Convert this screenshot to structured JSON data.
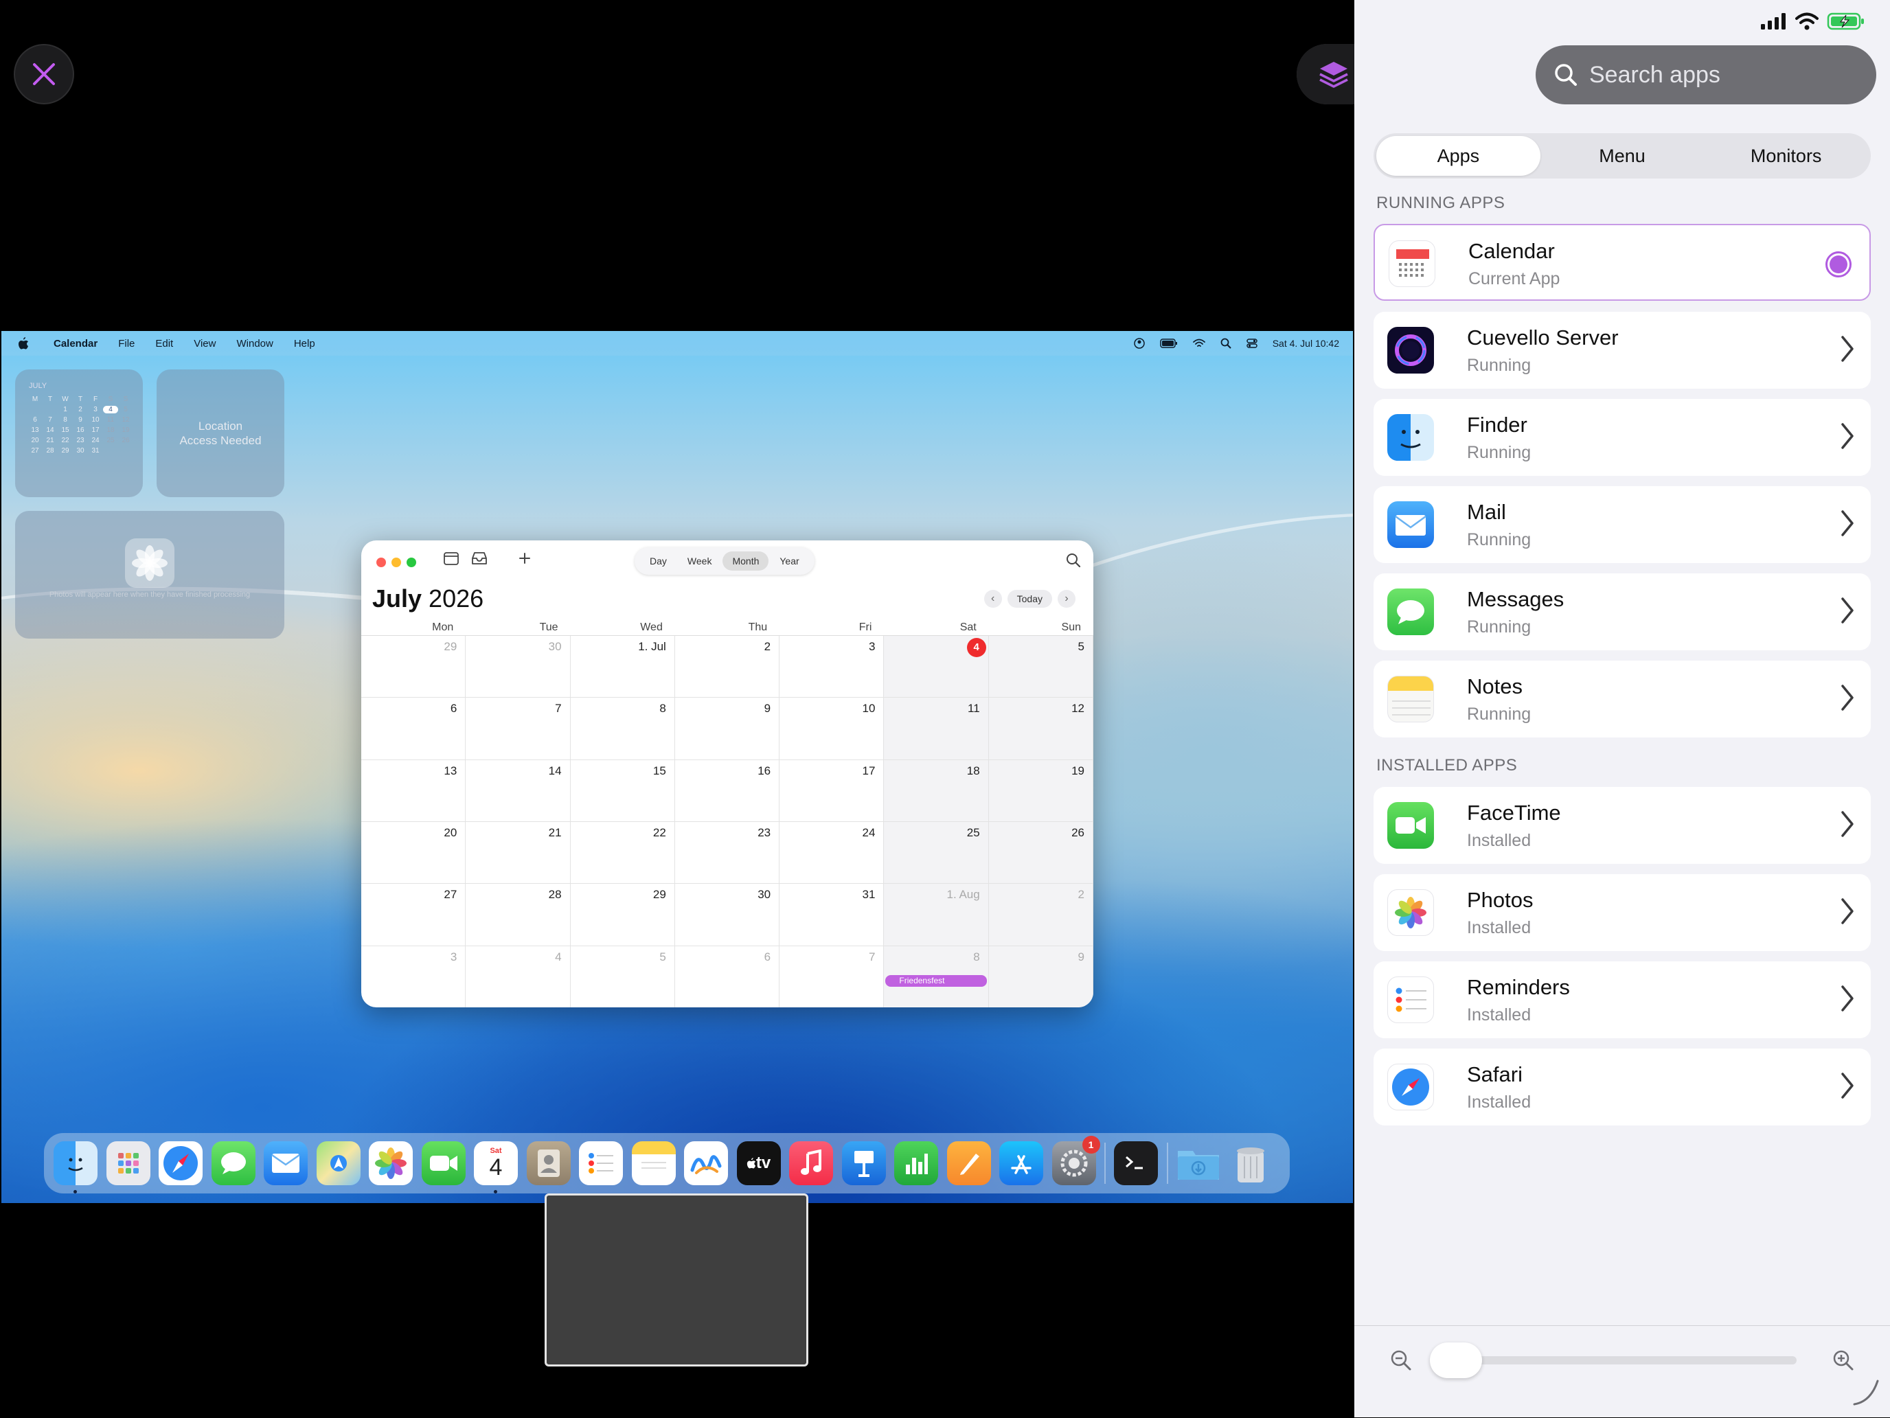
{
  "mac": {
    "menubar": {
      "app_name": "Calendar",
      "menus": [
        "File",
        "Edit",
        "View",
        "Window",
        "Help"
      ],
      "clock": "Sat 4. Jul 10:42"
    },
    "widgets": {
      "calendar_month": "JULY",
      "calendar_weekdays": [
        "M",
        "T",
        "W",
        "T",
        "F",
        "S",
        "S"
      ],
      "calendar_days": [
        "",
        "",
        "1",
        "2",
        "3",
        "4",
        "5",
        "6",
        "7",
        "8",
        "9",
        "10",
        "11",
        "12",
        "13",
        "14",
        "15",
        "16",
        "17",
        "18",
        "19",
        "20",
        "21",
        "22",
        "23",
        "24",
        "25",
        "26",
        "27",
        "28",
        "29",
        "30",
        "31"
      ],
      "location_text": "Location Access Needed",
      "photos_text": "Photos will appear here when they have finished processing"
    },
    "calendar_window": {
      "views": [
        "Day",
        "Week",
        "Month",
        "Year"
      ],
      "active_view": "Month",
      "title_month": "July",
      "title_year": " 2026",
      "today_label": "Today",
      "weekdays": [
        "Mon",
        "Tue",
        "Wed",
        "Thu",
        "Fri",
        "Sat",
        "Sun"
      ],
      "days": [
        [
          "29",
          "30",
          "1. Jul",
          "2",
          "3",
          "4",
          "5"
        ],
        [
          "6",
          "7",
          "8",
          "9",
          "10",
          "11",
          "12"
        ],
        [
          "13",
          "14",
          "15",
          "16",
          "17",
          "18",
          "19"
        ],
        [
          "20",
          "21",
          "22",
          "23",
          "24",
          "25",
          "26"
        ],
        [
          "27",
          "28",
          "29",
          "30",
          "31",
          "1. Aug",
          "2"
        ],
        [
          "3",
          "4",
          "5",
          "6",
          "7",
          "8",
          "9"
        ]
      ],
      "event": "Friedensfest"
    },
    "dock": {
      "apps": [
        "Finder",
        "Launchpad",
        "Safari",
        "Messages",
        "Mail",
        "Maps",
        "Photos",
        "FaceTime",
        "Calendar",
        "Contacts",
        "Reminders",
        "Notes",
        "Freeform",
        "TV",
        "Music",
        "Keynote",
        "Numbers",
        "Pages",
        "App Store",
        "System Settings",
        "Terminal",
        "Downloads",
        "Trash"
      ],
      "calendar_icon_day": "Sat",
      "calendar_icon_date": "4",
      "tv_label": "tv",
      "settings_badge": "1"
    }
  },
  "panel": {
    "search_placeholder": "Search apps",
    "tabs": [
      "Apps",
      "Menu",
      "Monitors"
    ],
    "active_tab": "Apps",
    "running_header": "RUNNING APPS",
    "installed_header": "INSTALLED APPS",
    "running_apps": [
      {
        "name": "Calendar",
        "status": "Current App"
      },
      {
        "name": "Cuevello Server",
        "status": "Running"
      },
      {
        "name": "Finder",
        "status": "Running"
      },
      {
        "name": "Mail",
        "status": "Running"
      },
      {
        "name": "Messages",
        "status": "Running"
      },
      {
        "name": "Notes",
        "status": "Running"
      }
    ],
    "installed_apps": [
      {
        "name": "FaceTime",
        "status": "Installed"
      },
      {
        "name": "Photos",
        "status": "Installed"
      },
      {
        "name": "Reminders",
        "status": "Installed"
      },
      {
        "name": "Safari",
        "status": "Installed"
      }
    ]
  },
  "colors": {
    "accent": "#b05be0",
    "today_red": "#ef2b2d",
    "event": "#c061e0"
  }
}
